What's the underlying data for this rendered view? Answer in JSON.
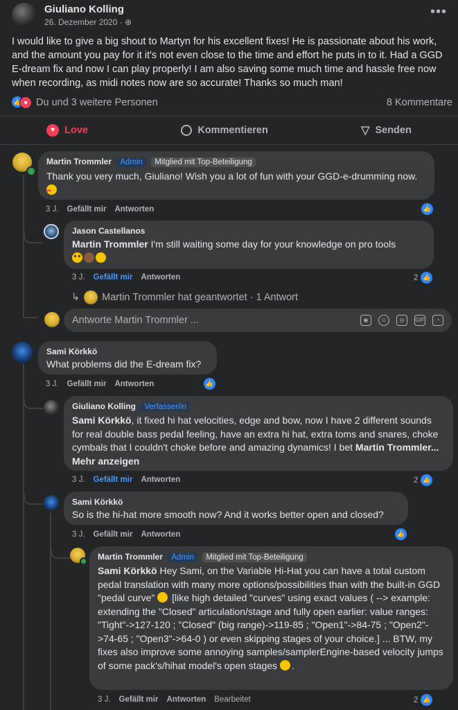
{
  "post": {
    "author": "Giuliano Kolling",
    "date": "26. Dezember 2020 · ",
    "privacy_icon": "globe-icon",
    "text": "I would like to give a big shout to Martyn for his excellent fixes! He is passionate about his work, and the amount you pay for it it's not even close to the time and effort he puts in to it. Had a GGD E-dream fix and now I can play properly! I am also saving some much time and hassle free now when recording, as midi notes now are so accurate! Thanks so much man!",
    "reactions_text": "Du und 3 weitere Personen",
    "comments_count": "8 Kommentare"
  },
  "actions": {
    "love": "Love",
    "comment": "Kommentieren",
    "send": "Senden"
  },
  "comments": [
    {
      "author": "Martin Trommler",
      "badge1": "Admin",
      "badge2": "Mitglied mit Top-Beteiligung",
      "text": "Thank you very much, Giuliano! Wish you a lot of fun with your GGD-e-drumming now. ",
      "time": "3 J.",
      "like": "Gefällt mir",
      "reply": "Antworten"
    },
    {
      "author": "Jason Castellanos",
      "mention": "Martin Trommler",
      "text": " I'm still waiting some day for your knowledge on pro tools",
      "time": "3 J.",
      "like": "Gefällt mir",
      "reply": "Antworten",
      "react_count": "2"
    },
    {
      "replied_summary": "Martin Trommler hat geantwortet · 1 Antwort",
      "reply_placeholder": "Antworte Martin Trommler ..."
    },
    {
      "author": "Sami Körkkö",
      "text": "What problems did the E-dream fix?",
      "time": "3 J.",
      "like": "Gefällt mir",
      "reply": "Antworten"
    },
    {
      "author": "Giuliano Kolling",
      "badge1": "Verfasser/in",
      "mention": "Sami Körkkö",
      "text": ", it fixed hi hat velocities, edge and bow, now I have 2 different sounds for real double bass pedal feeling, have an extra hi hat, extra toms and snares, choke cymbals that I couldn't choke before and amazing dynamics! I bet ",
      "mention2": "Martin Trommler",
      "more": "... Mehr anzeigen",
      "time": "3 J.",
      "like": "Gefällt mir",
      "reply": "Antworten",
      "react_count": "2"
    },
    {
      "author": "Sami Körkkö",
      "text": "So is the hi-hat more smooth now? And it works better open and closed?",
      "time": "3 J.",
      "like": "Gefällt mir",
      "reply": "Antworten"
    },
    {
      "author": "Martin Trommler",
      "badge1": "Admin",
      "badge2": "Mitglied mit Top-Beteiligung",
      "mention": "Sami Körkkö",
      "text": " Hey Sami, on the Variable Hi-Hat you can have a total custom pedal translation with many more options/possibilities than with the built-in GGD \"pedal curve\" ",
      "text2": " [like high detailed \"curves\" using exact values ( --> example: extending the \"Closed\" articulation/stage and fully open earlier: value ranges: \"Tight\"->127-120 ; \"Closed\" (big range)->119-85 ; \"Open1\"->84-75 ; \"Open2\"->74-65 ; \"Open3\"->64-0 ) or even skipping stages of your choice.] ... BTW, my fixes also improve some annoying samples/samplerEngine-based velocity jumps of some pack's/hihat model's open stages ",
      "text3": ".",
      "time": "3 J.",
      "like": "Gefällt mir",
      "reply": "Antworten",
      "edited": "Bearbeitet",
      "react_count": "2"
    }
  ],
  "colors": {
    "accent": "#2d88ff",
    "love": "#f33e58",
    "bg": "#242526",
    "bubble": "#3a3b3c"
  }
}
